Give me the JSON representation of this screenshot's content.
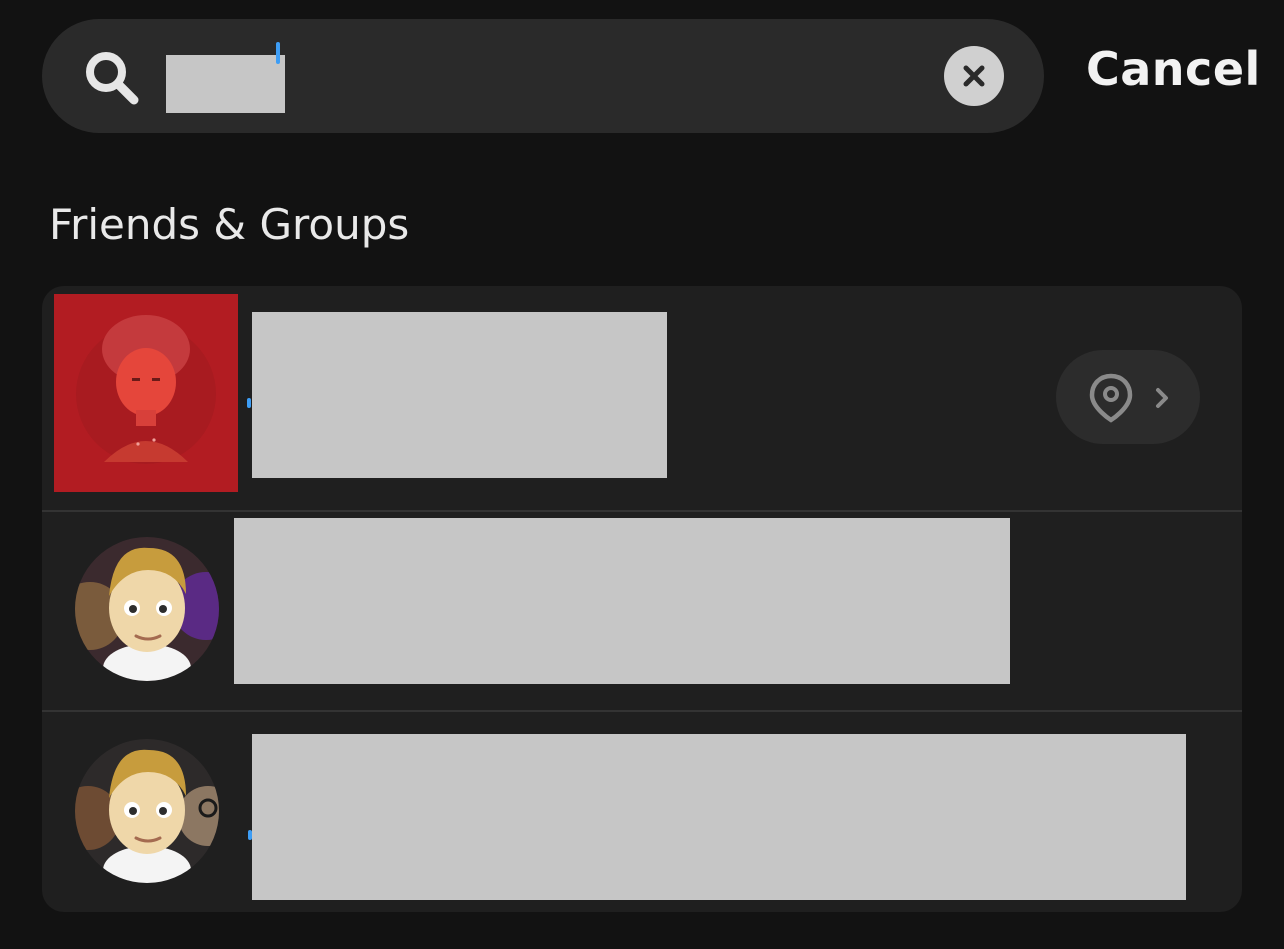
{
  "search": {
    "value": "",
    "clear_icon": "close-icon",
    "cancel_label": "Cancel"
  },
  "section": {
    "title": "Friends & Groups"
  },
  "results": [
    {
      "avatar": "bitmoji-turban-red",
      "name_hidden": true,
      "action_icon": "map-pin-icon"
    },
    {
      "avatar": "group-bitmoji-blond",
      "name_hidden": true
    },
    {
      "avatar": "group-bitmoji-blond-2",
      "name_hidden": true
    }
  ],
  "colors": {
    "background": "#121212",
    "search_bg": "#2a2a2a",
    "card_bg": "#1f1f1f",
    "accent_blue": "#3d9df5",
    "avatar_red": "#b21c22"
  }
}
